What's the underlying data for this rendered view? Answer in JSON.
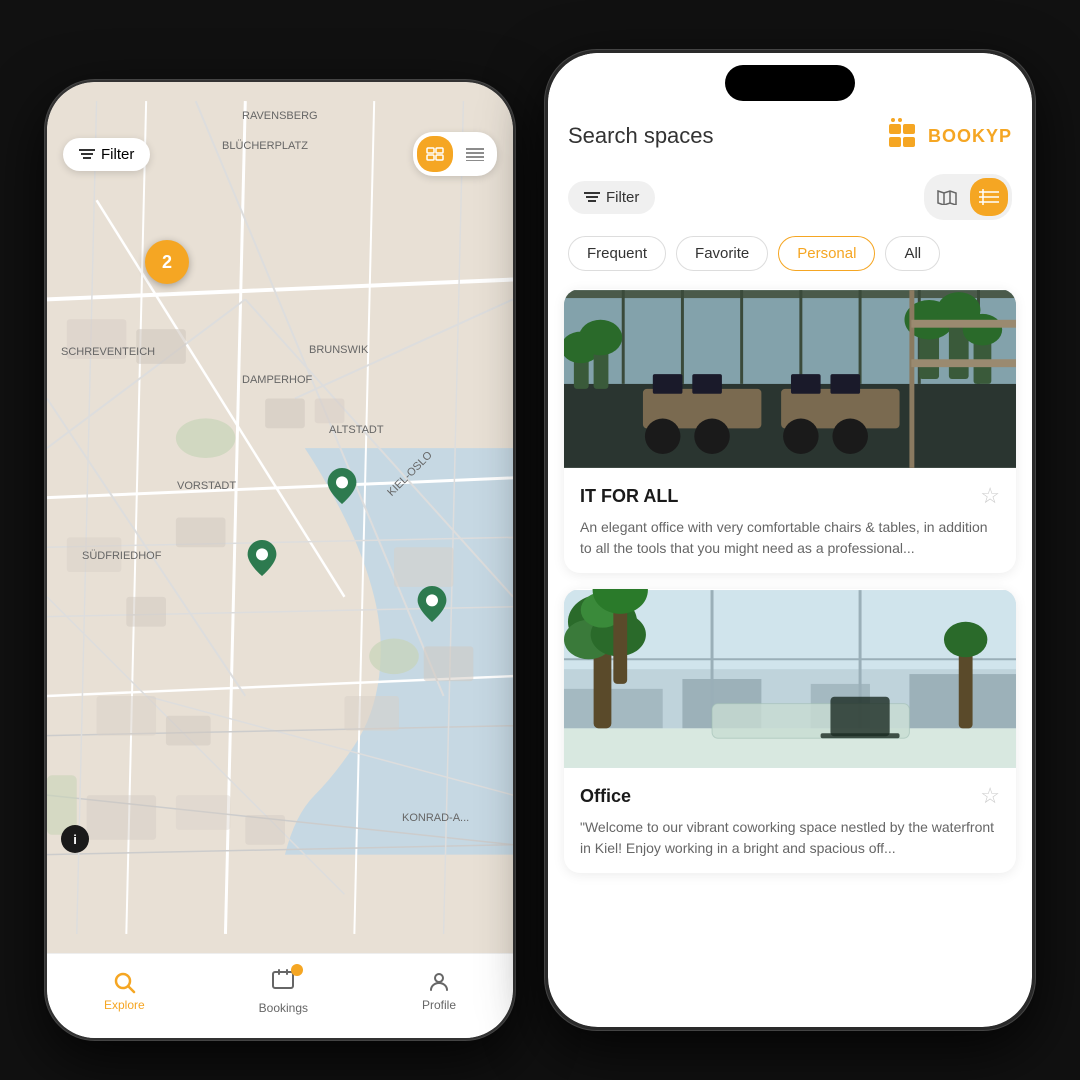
{
  "app": {
    "name": "BOOKYP",
    "logo_icon": "🏢"
  },
  "phone_left": {
    "map": {
      "cluster_count": "2",
      "labels": [
        {
          "text": "RAVENSBERG",
          "x": "200",
          "y": "30"
        },
        {
          "text": "BLÜCHERPLATZ",
          "x": "180",
          "y": "62"
        },
        {
          "text": "SCHREVENTEICH",
          "x": "20",
          "y": "268"
        },
        {
          "text": "BRUNSWIK",
          "x": "270",
          "y": "266"
        },
        {
          "text": "DAMPERHOF",
          "x": "202",
          "y": "296"
        },
        {
          "text": "ALTSTADT",
          "x": "290",
          "y": "346"
        },
        {
          "text": "VORSTADT",
          "x": "136",
          "y": "402"
        },
        {
          "text": "KIEL-OSLO",
          "x": "340",
          "y": "390"
        },
        {
          "text": "SÜDFRIEDHOF",
          "x": "40",
          "y": "472"
        },
        {
          "text": "KONRAD-A...",
          "x": "360",
          "y": "736"
        }
      ],
      "filter_label": "Filter",
      "info_label": "i"
    },
    "bottom_nav": {
      "items": [
        {
          "label": "Explore",
          "icon": "🔍",
          "active": true
        },
        {
          "label": "Bookings",
          "icon": "🎫",
          "active": false,
          "badge": true
        },
        {
          "label": "Profile",
          "icon": "👤",
          "active": false
        }
      ]
    }
  },
  "phone_right": {
    "header": {
      "search_placeholder": "Search spaces",
      "logo_text": "BOOKYP"
    },
    "filter": {
      "filter_label": "Filter",
      "map_icon": "🗺",
      "grid_icon": "☰"
    },
    "categories": [
      {
        "label": "Frequent",
        "active": false
      },
      {
        "label": "Favorite",
        "active": false
      },
      {
        "label": "Personal",
        "active": true
      },
      {
        "label": "All",
        "active": false
      }
    ],
    "spaces": [
      {
        "title": "IT FOR ALL",
        "description": "An elegant office with very comfortable chairs & tables, in addition to all the tools that you might need as a professional...",
        "favorited": false
      },
      {
        "title": "Office",
        "description": "\"Welcome to our vibrant coworking space nestled by the waterfront in Kiel! Enjoy working in a bright and spacious off...",
        "favorited": false
      }
    ]
  }
}
